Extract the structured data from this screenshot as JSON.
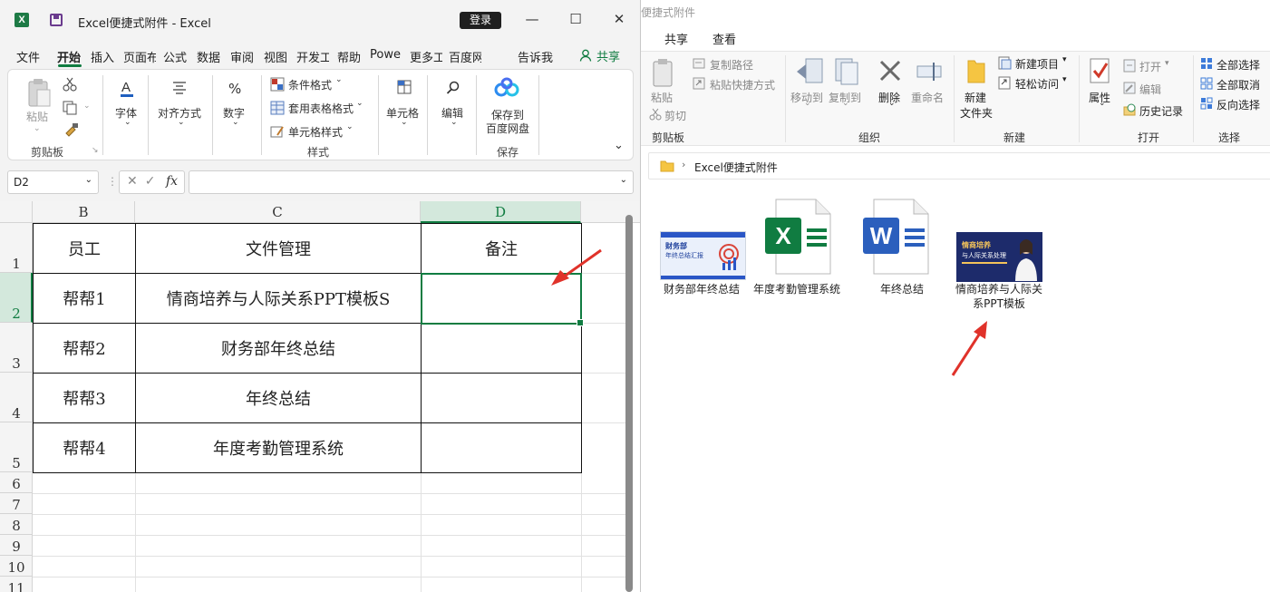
{
  "excel": {
    "logo_letter": "X",
    "title": "Excel便捷式附件  -  Excel",
    "login": "登录",
    "window_controls": {
      "minimize": "—",
      "maximize": "☐",
      "close": "✕"
    },
    "tabs": [
      "文件",
      "开始",
      "插入",
      "页面布",
      "公式",
      "数据",
      "审阅",
      "视图",
      "开发工",
      "帮助",
      "Powe",
      "更多工",
      "百度网"
    ],
    "active_tab": "开始",
    "tell_me": "告诉我",
    "share": "共享",
    "ribbon": {
      "paste": "粘贴",
      "clipboard": "剪贴板",
      "font": "字体",
      "align": "对齐方式",
      "number": "数字",
      "conditional": "条件格式",
      "table_format": "套用表格格式",
      "cell_style": "单元格样式",
      "styles": "样式",
      "cells": "单元格",
      "editing": "编辑",
      "save_to_line1": "保存到",
      "save_to_line2": "百度网盘",
      "save_group": "保存"
    },
    "name_box": "D2",
    "fx": "fx",
    "columns": [
      "B",
      "C",
      "D"
    ],
    "rows": [
      "1",
      "2",
      "3",
      "4",
      "5",
      "6",
      "7",
      "8",
      "9",
      "10",
      "11"
    ],
    "table": [
      [
        "员工",
        "文件管理",
        "备注"
      ],
      [
        "帮帮1",
        "情商培养与人际关系PPT模板S",
        ""
      ],
      [
        "帮帮2",
        "财务部年终总结",
        ""
      ],
      [
        "帮帮3",
        "年终总结",
        ""
      ],
      [
        "帮帮4",
        "年度考勤管理系统",
        ""
      ]
    ],
    "selected_cell": "D2",
    "accent": "#107c41"
  },
  "explorer": {
    "title": "便捷式附件",
    "tabs": [
      "共享",
      "查看"
    ],
    "ribbon": {
      "paste": "粘贴",
      "copy_path": "复制路径",
      "paste_shortcut": "粘贴快捷方式",
      "cut": "剪切",
      "clipboard": "剪贴板",
      "move_to": "移动到",
      "copy_to": "复制到",
      "delete": "删除",
      "rename": "重命名",
      "organize": "组织",
      "new_folder_1": "新建",
      "new_folder_2": "文件夹",
      "new_item": "新建项目",
      "easy_access": "轻松访问",
      "new_group": "新建",
      "properties": "属性",
      "open": "打开",
      "edit": "编辑",
      "history": "历史记录",
      "open_group": "打开",
      "select_all": "全部选择",
      "select_none": "全部取消",
      "invert": "反向选择",
      "select_group": "选择"
    },
    "address": "Excel便捷式附件",
    "files": [
      {
        "name": "财务部年终总结",
        "thumb_text_1": "财务部",
        "thumb_text_2": "年终总结汇报"
      },
      {
        "name": "年度考勤管理系统",
        "icon_letter": "X"
      },
      {
        "name": "年终总结",
        "icon_letter": "W"
      },
      {
        "name": "情商培养与人际关系PPT模板",
        "thumb_text_1": "情商培养",
        "thumb_text_2": "与人际关系处理"
      }
    ]
  }
}
